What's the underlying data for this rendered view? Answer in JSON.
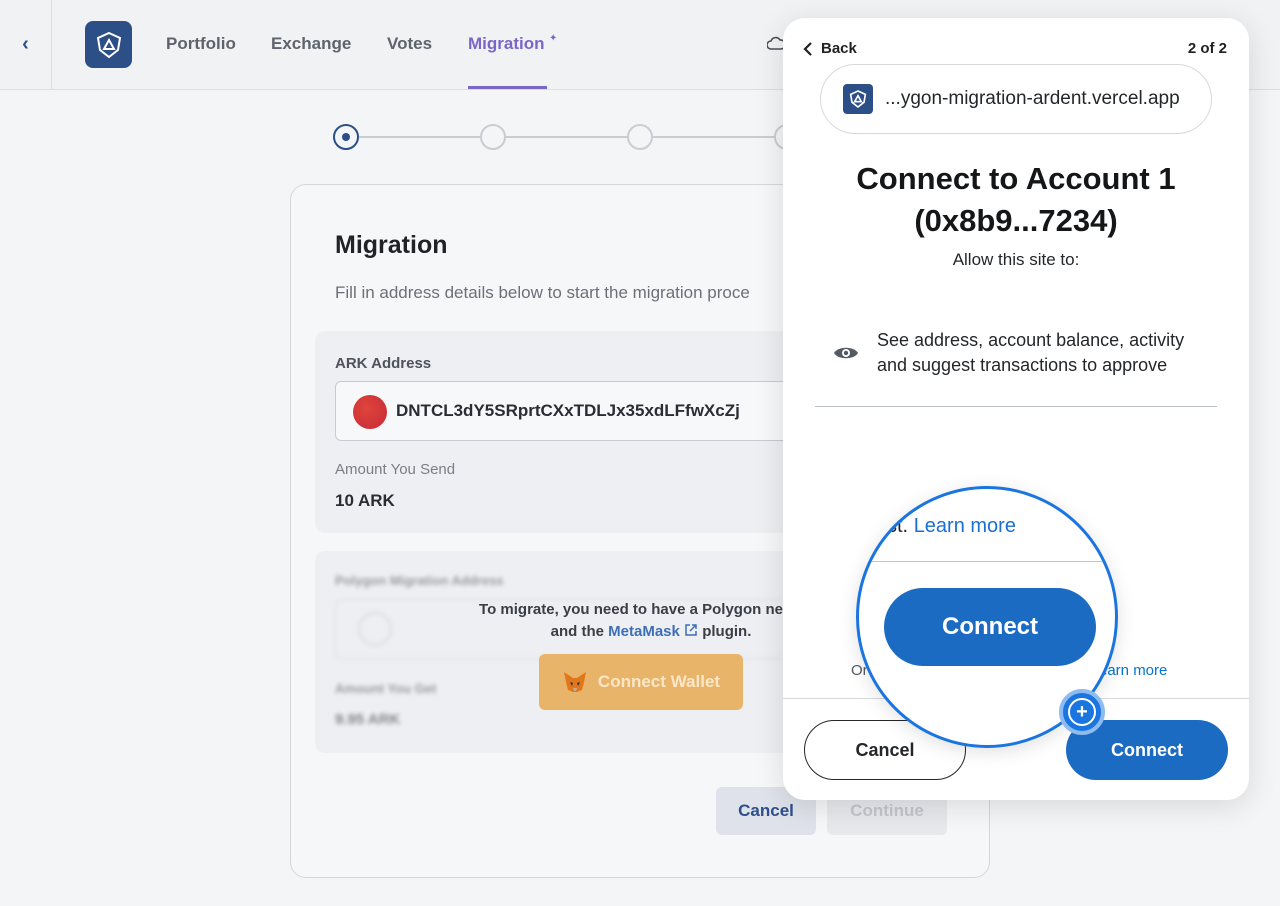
{
  "nav": {
    "back_glyph": "‹",
    "items": [
      "Portfolio",
      "Exchange",
      "Votes",
      "Migration"
    ],
    "active": "Migration"
  },
  "migration_card": {
    "title": "Migration",
    "subtitle": "Fill in address details below to start the migration proce",
    "ark_address_label": "ARK Address",
    "ark_address_value": "DNTCL3dY5SRprtCXxTDLJx35xdLFfwXcZj",
    "amount_send_label": "Amount You Send",
    "amount_send_value": "10 ARK",
    "polygon_label": "Polygon Migration Address",
    "amount_get_label": "Amount You Get",
    "amount_get_value": "9.95 ARK",
    "overlay_line1": "To migrate, you need to have a Polygon network",
    "overlay_line2_prefix": "and the",
    "overlay_link": "MetaMask",
    "overlay_line2_suffix": "plugin.",
    "connect_wallet_label": "Connect Wallet",
    "cancel_label": "Cancel",
    "continue_label": "Continue"
  },
  "metamask": {
    "back_label": "Back",
    "page_indicator": "2 of 2",
    "site_url": "...ygon-migration-ardent.vercel.app",
    "title_line1": "Connect to Account 1",
    "title_line2": "(0x8b9...7234)",
    "allow_text": "Allow this site to:",
    "permission_text": "See address, account balance, activity and suggest transactions to approve",
    "only_text": "Or",
    "learn_more_footer": "earn more",
    "cancel_label": "Cancel",
    "connect_label": "Connect"
  },
  "magnifier": {
    "partial_text": "st.",
    "learn_more": "Learn more",
    "connect_label": "Connect",
    "badge_glyph": "+"
  },
  "colors": {
    "accent_purple": "#7b66c8",
    "brand_navy": "#2b4f86",
    "metamask_blue": "#1b6bc2",
    "lens_blue": "#1a75e0"
  }
}
